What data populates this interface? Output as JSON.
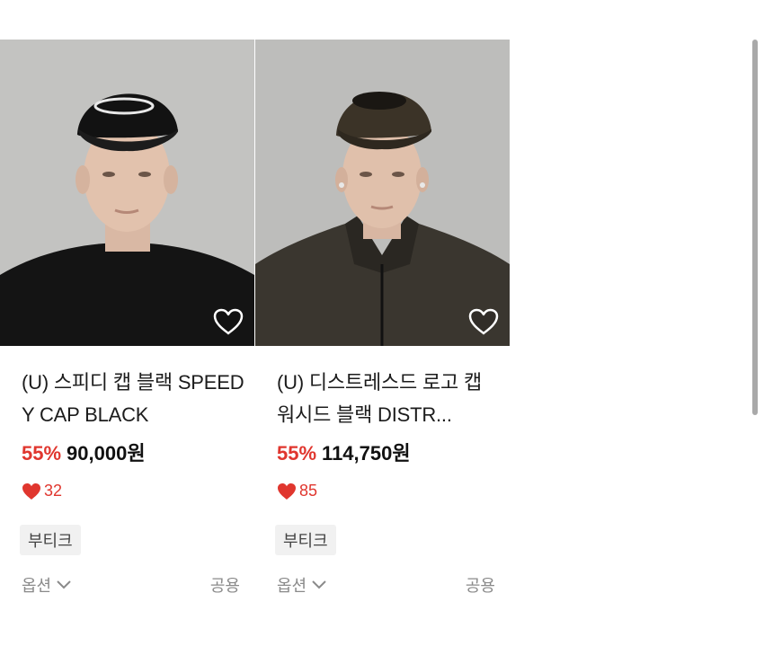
{
  "products": [
    {
      "title": "(U) 스피디 캡 블랙 SPEEDY CAP BLACK",
      "discount": "55%",
      "price": "90,000원",
      "likes": "32",
      "tag": "부티크",
      "option_label": "옵션",
      "gender": "공용"
    },
    {
      "title": "(U) 디스트레스드 로고 캡 워시드 블랙 DISTR...",
      "discount": "55%",
      "price": "114,750원",
      "likes": "85",
      "tag": "부티크",
      "option_label": "옵션",
      "gender": "공용"
    }
  ],
  "icons": {
    "wishlist": "heart-outline-icon",
    "likes": "heart-filled-icon",
    "dropdown": "chevron-down-icon"
  },
  "colors": {
    "accent_red": "#e0362e",
    "muted_gray": "#8a8a8a",
    "tag_bg": "#f1f1f1"
  }
}
